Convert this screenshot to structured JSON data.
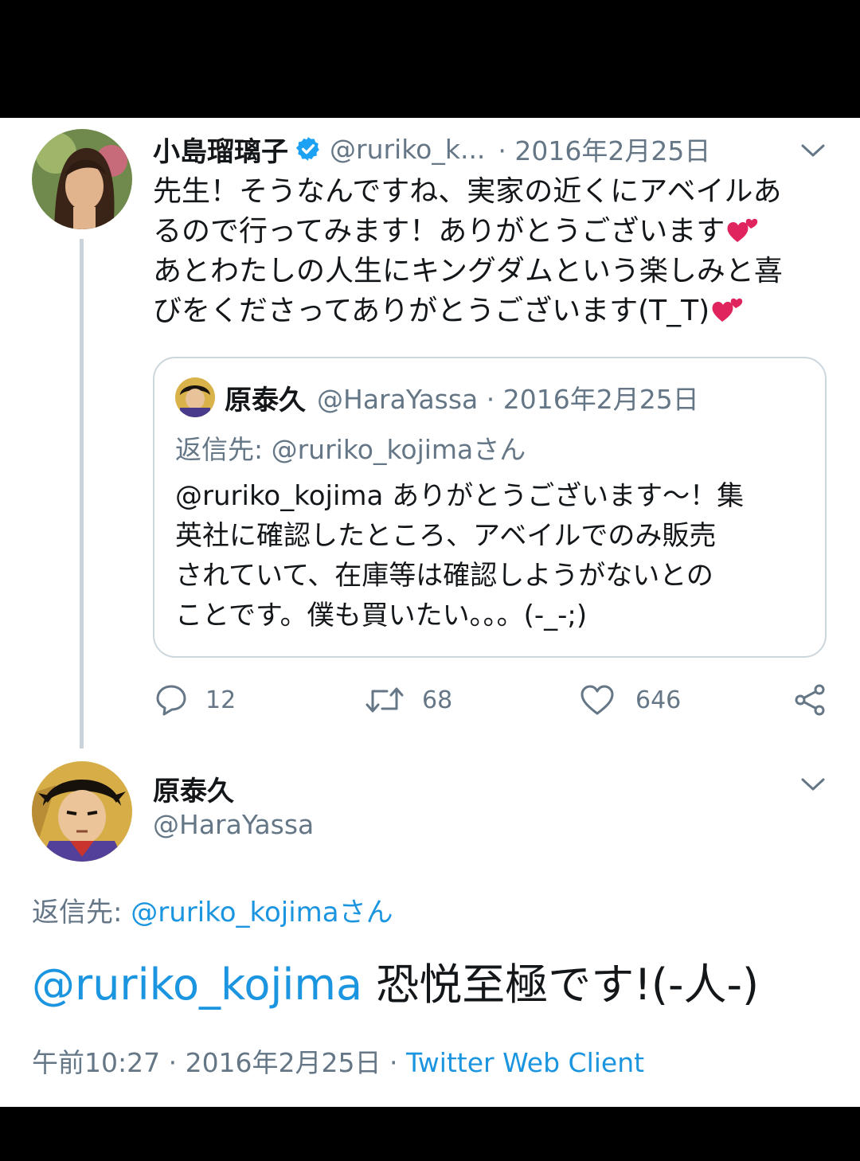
{
  "main_tweet": {
    "author_name": "小島瑠璃子",
    "handle": "@ruriko_k...",
    "date": "· 2016年2月25日",
    "body_lines": [
      "先生！そうなんですね、実家の近くにアベイルあ",
      "るので行ってみます！ありがとうございます",
      "あとわたしの人生にキングダムという楽しみと喜",
      "びをくださってありがとうございます(T_T)"
    ],
    "quoted": {
      "author_name": "原泰久",
      "meta": "@HaraYassa · 2016年2月25日",
      "reply_to": "返信先: @ruriko_kojimaさん",
      "body_lines": [
        "@ruriko_kojima ありがとうございます～！集",
        "英社に確認したところ、アベイルでのみ販売",
        "されていて、在庫等は確認しようがないとの",
        "ことです。僕も買いたい。。。(-_-;)"
      ]
    },
    "actions": {
      "replies": "12",
      "retweets": "68",
      "likes": "646"
    }
  },
  "reply_tweet": {
    "author_name": "原泰久",
    "handle": "@HaraYassa",
    "reply_to_label": "返信先: ",
    "reply_to_user": "@ruriko_kojimaさん",
    "mention": "@ruriko_kojima",
    "body_text": " 恐悦至極です!(-人-)",
    "timestamp": "午前10:27 · 2016年2月25日 · ",
    "source": "Twitter Web Client"
  },
  "colors": {
    "link": "#1b95e0",
    "secondary_text": "#657786",
    "primary_text": "#14171a",
    "verified": "#1da1f2",
    "heart_emoji": "#e0245e"
  }
}
